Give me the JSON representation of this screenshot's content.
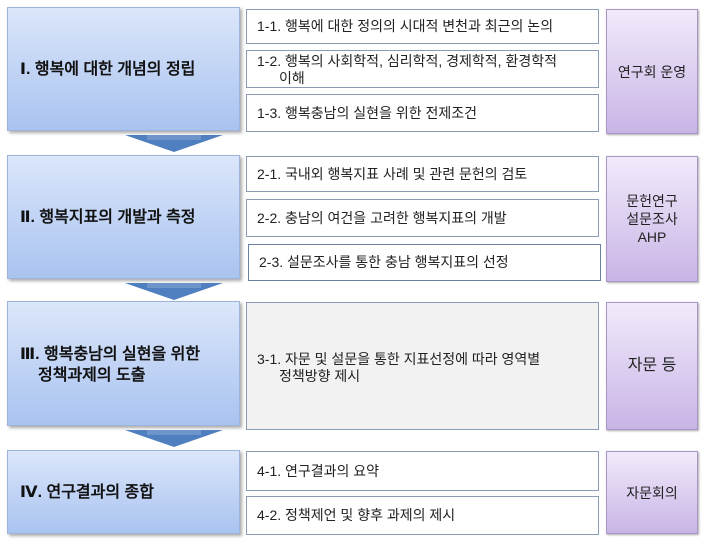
{
  "stages": [
    {
      "title": "Ⅰ. 행복에 대한 개념의 정립",
      "items": [
        "1-1. 행복에 대한 정의의 시대적 변천과 최근의 논의",
        [
          "1-2. 행복의 사회학적, 심리학적, 경제학적, 환경학적",
          "이해"
        ],
        "1-3. 행복충남의 실현을 위한 전제조건"
      ],
      "method": "연구회 운영"
    },
    {
      "title": "Ⅱ. 행복지표의 개발과 측정",
      "items": [
        "2-1. 국내외 행복지표 사례 및 관련 문헌의 검토",
        "2-2. 충남의 여건을 고려한 행복지표의 개발",
        "2-3. 설문조사를 통한 충남 행복지표의 선정"
      ],
      "method": "문헌연구\n설문조사\nAHP"
    },
    {
      "title": [
        "Ⅲ. 행복충남의 실현을 위한",
        "정책과제의 도출"
      ],
      "items": [
        [
          "3-1. 자문 및 설문을 통한 지표선정에 따라 영역별",
          "정책방향 제시"
        ]
      ],
      "method": "자문 등"
    },
    {
      "title": "Ⅳ. 연구결과의 종합",
      "items": [
        "4-1. 연구결과의 요약",
        "4-2. 정책제언 및 향후 과제의 제시"
      ],
      "method": "자문회의"
    }
  ],
  "colors": {
    "stage": "#a9c3f0",
    "method": "#c8b5e6",
    "arrow": "#4f7fbf"
  }
}
